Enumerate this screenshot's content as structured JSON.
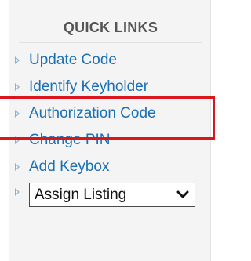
{
  "quick_links": {
    "heading": "QUICK LINKS",
    "items": [
      {
        "label": "Update Code"
      },
      {
        "label": "Identify Keyholder"
      },
      {
        "label": "Authorization Code"
      },
      {
        "label": "Change PIN"
      },
      {
        "label": "Add Keybox"
      }
    ],
    "select": {
      "selected": "Assign Listing"
    }
  },
  "colors": {
    "link": "#1b6fb3",
    "highlight_box": "#d9161c",
    "panel_bg": "#f4f4f4",
    "heading": "#555555"
  },
  "icons": {
    "bullet": "triangle-arrow-icon",
    "select": "chevron-down-icon"
  },
  "highlighted_item": "Authorization Code"
}
